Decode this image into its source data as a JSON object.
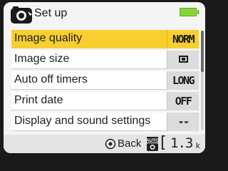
{
  "header": {
    "title": "Set up",
    "battery_color": "#8ad43a"
  },
  "menu": {
    "items": [
      {
        "label": "Image quality",
        "value": "NORM",
        "selected": true
      },
      {
        "label": "Image size",
        "value": "",
        "value_icon": "image-size-icon",
        "selected": false
      },
      {
        "label": "Auto off timers",
        "value": "LONG",
        "selected": false
      },
      {
        "label": "Print date",
        "value": "OFF",
        "selected": false
      },
      {
        "label": "Display and sound settings",
        "value": "--",
        "selected": false
      }
    ],
    "selected_color": "#f8cf2e"
  },
  "footer": {
    "back_label": "Back",
    "back_icon": "multi-selector-icon",
    "mode_icon": "auto-mode-icon",
    "bracket": "[",
    "remaining": "1.3",
    "unit": "k"
  }
}
